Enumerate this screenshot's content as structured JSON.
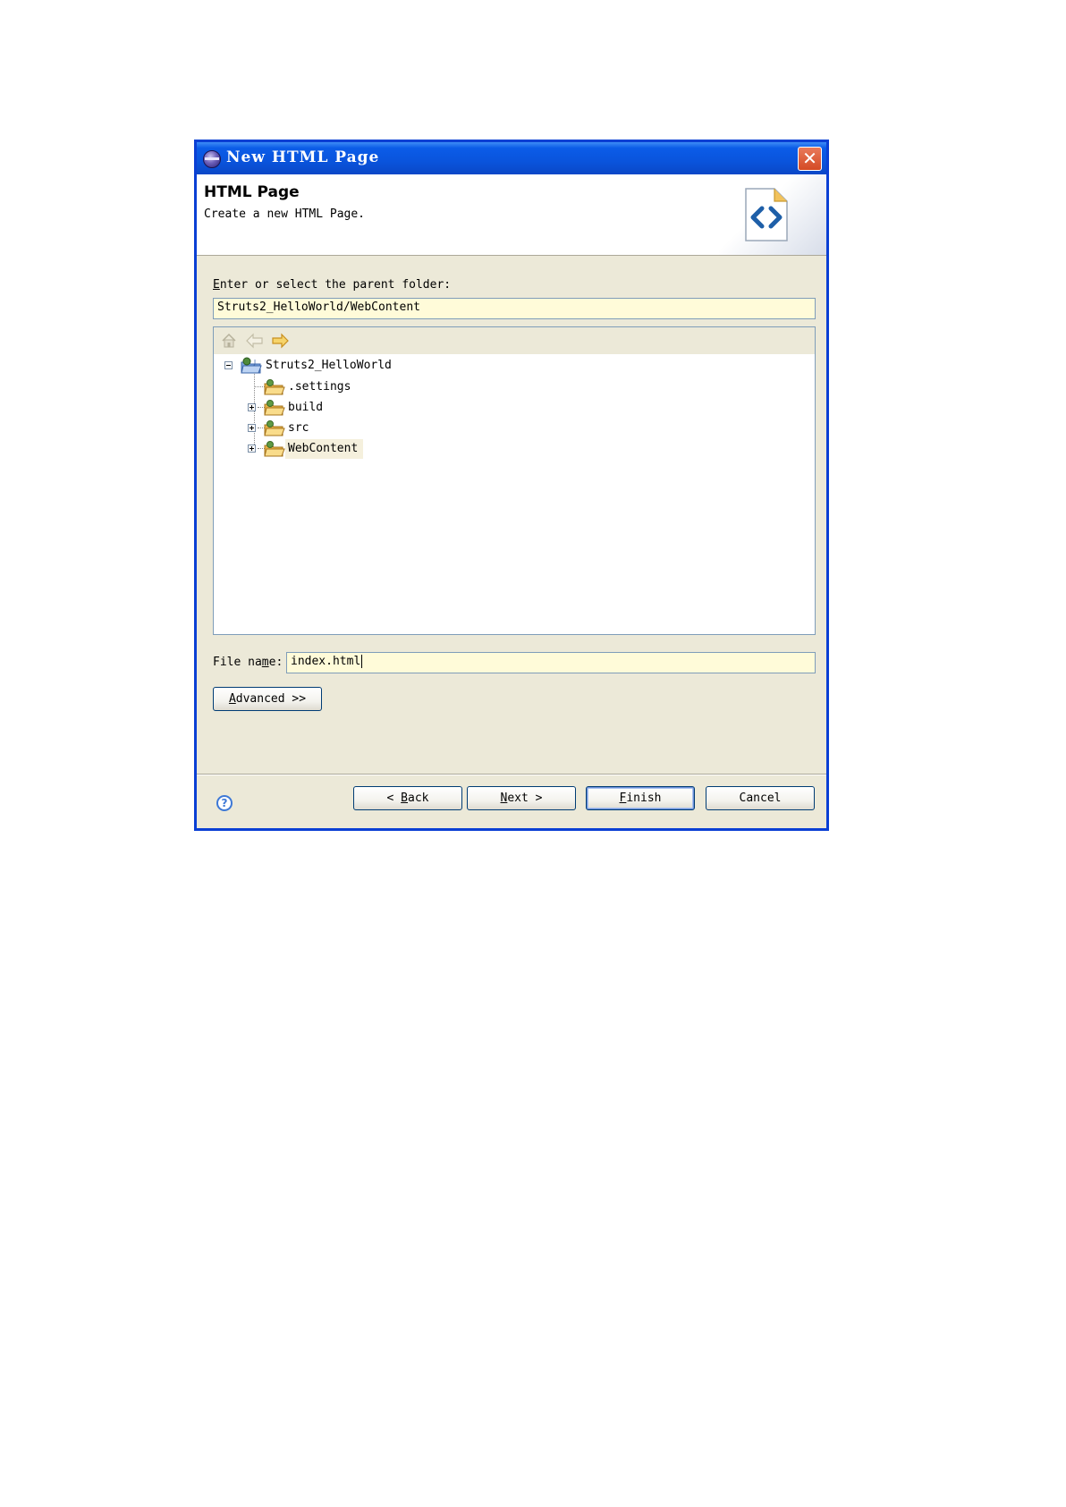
{
  "window": {
    "title": "New HTML Page",
    "close_glyph": "✕"
  },
  "header": {
    "title": "HTML Page",
    "description": "Create a new HTML Page.",
    "icon": "html-file-icon"
  },
  "folder_section": {
    "label_mnemonic": "E",
    "label_rest": "nter or select the parent folder:",
    "value": "Struts2_HelloWorld/WebContent"
  },
  "tree_toolbar": {
    "icons": [
      "home-icon",
      "back-arrow-icon",
      "forward-arrow-icon"
    ]
  },
  "tree": {
    "project": "Struts2_HelloWorld",
    "children": [
      {
        "label": ".settings",
        "expandable": false
      },
      {
        "label": "build",
        "expandable": true
      },
      {
        "label": "src",
        "expandable": true
      },
      {
        "label": "WebContent",
        "expandable": true,
        "selected": true
      }
    ]
  },
  "file_name": {
    "label_pre": "File na",
    "label_mnemonic": "m",
    "label_post": "e:",
    "value": "index.html"
  },
  "advanced_button": {
    "mnemonic": "A",
    "rest": "dvanced >>"
  },
  "footer": {
    "back": {
      "prefix": "< ",
      "mnemonic": "B",
      "rest": "ack"
    },
    "next": {
      "mnemonic": "N",
      "rest": "ext",
      "suffix": " >"
    },
    "finish": {
      "mnemonic": "F",
      "rest": "inish"
    },
    "cancel": "Cancel",
    "help_glyph": "?"
  },
  "colors": {
    "titlebar": "#0a54dc",
    "dialog_bg": "#ece9d8",
    "field_bg": "#fffbd9",
    "selection_bg": "#f5f0dd"
  }
}
